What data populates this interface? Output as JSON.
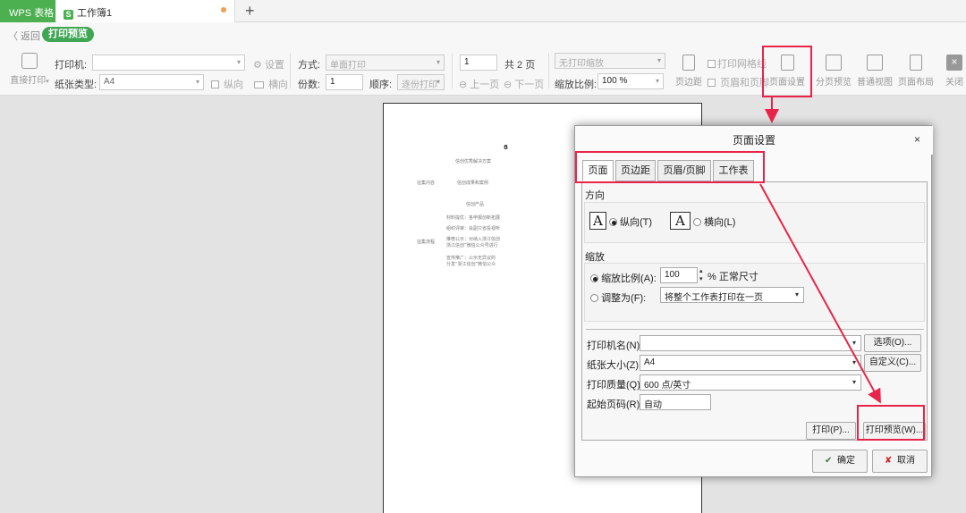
{
  "tabs": {
    "app": "WPS 表格",
    "book_icon": "S",
    "book": "工作簿1"
  },
  "subbar": {
    "back": "〈 返回",
    "mode": "打印预览"
  },
  "toolbar": {
    "direct_print": "直接打印",
    "printer_label": "打印机:",
    "paper_label": "纸张类型:",
    "paper_value": "A4",
    "settings": "设置",
    "portrait": "纵向",
    "landscape": "横向",
    "method_label": "方式:",
    "method_value": "单面打印",
    "copies_label": "份数:",
    "copies_value": "1",
    "order_label": "顺序:",
    "order_value": "逐份打印",
    "page_value": "1",
    "total_pages": "共 2 页",
    "prev_page": "上一页",
    "next_page": "下一页",
    "scale_mode": "无打印缩放",
    "scale_label": "缩放比例:",
    "scale_value": "100 %",
    "print_gridlines": "打印网格线",
    "margins": "页边距",
    "header_footer": "页眉和页脚",
    "page_setup": "页面设置",
    "page_break_preview": "分页预览",
    "normal_view": "普通视图",
    "page_layout": "页面布局",
    "close": "关闭"
  },
  "paper": {
    "lines": [
      "信创优秀解决方案",
      "征集内容",
      "信创成果和案例",
      "信创产品",
      "材料提优：各申报创新拓展",
      "组织评审：会副只省投视听",
      "征集流程",
      "推荐公示：对纳入浙江信创",
      "浙江信创”微信公众号进行",
      "宣传推广：公示无异议的",
      "分发“浙江信创”微信公众"
    ],
    "mark": "8"
  },
  "dialog": {
    "title": "页面设置",
    "close": "×",
    "tabs": [
      "页面",
      "页边距",
      "页眉/页脚",
      "工作表"
    ],
    "orientation_label": "方向",
    "portrait": "纵向(T)",
    "landscape": "横向(L)",
    "scaling_label": "缩放",
    "scale_ratio": "缩放比例(A):",
    "scale_value": "100",
    "normal_size": "% 正常尺寸",
    "fit_to": "调整为(F):",
    "fit_value": "将整个工作表打印在一页",
    "printer_name": "打印机名(N)",
    "options": "选项(O)...",
    "paper_size": "纸张大小(Z):",
    "paper_value": "A4",
    "custom": "自定义(C)...",
    "quality": "打印质量(Q):",
    "quality_value": "600 点/英寸",
    "start_page": "起始页码(R):",
    "start_value": "自动",
    "print": "打印(P)...",
    "print_preview": "打印预览(W)...",
    "ok": "确定",
    "cancel": "取消"
  },
  "colors": {
    "brand_green": "#4caf50",
    "highlight_red": "#e8244a"
  }
}
